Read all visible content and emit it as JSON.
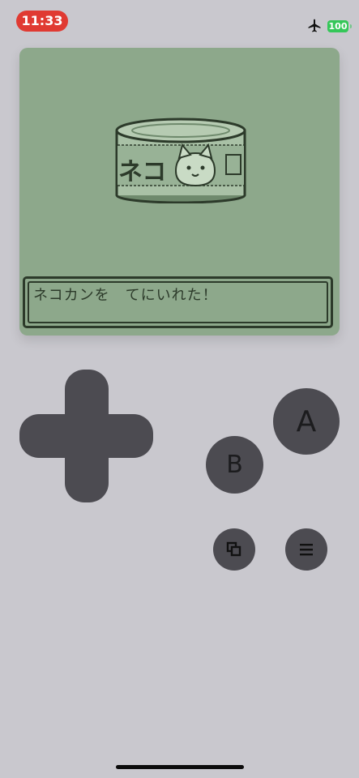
{
  "status_bar": {
    "time": "11:33",
    "battery_level": "100",
    "icons": [
      "airplane-icon",
      "battery-icon"
    ],
    "colors": {
      "time_pill": "#e03a32",
      "battery": "#35c759"
    }
  },
  "game": {
    "sprite": "neko-can-icon",
    "sprite_text": "ネコ",
    "dialog_text": "ネコカンを　てにいれた！",
    "colors": {
      "screen_bg": "#8da88b",
      "ink": "#2c3a2a"
    }
  },
  "controls": {
    "a_label": "A",
    "b_label": "B",
    "icons": [
      "dpad-icon",
      "swap-screen-icon",
      "menu-icon"
    ],
    "colors": {
      "button": "#4c4b51",
      "body": "#c9c8ce"
    }
  }
}
